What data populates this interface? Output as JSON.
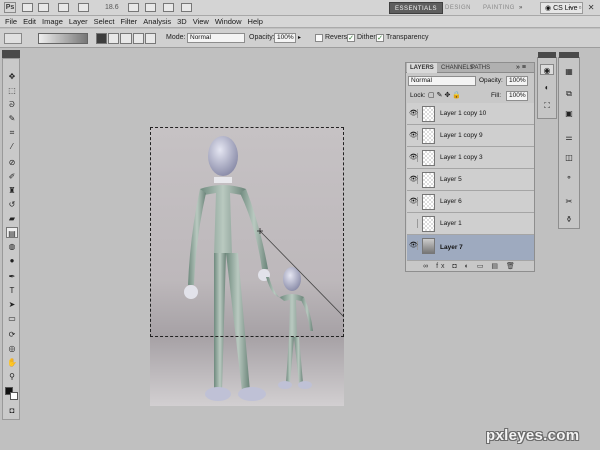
{
  "app": {
    "logo": "Ps",
    "zoom": "18.6",
    "workspaces": [
      "ESSENTIALS",
      "DESIGN",
      "PAINTING"
    ],
    "more": "»",
    "cs_live": "CS Live",
    "window_controls": "– ▫ ✕"
  },
  "menu": [
    "File",
    "Edit",
    "Image",
    "Layer",
    "Select",
    "Filter",
    "Analysis",
    "3D",
    "View",
    "Window",
    "Help"
  ],
  "options": {
    "mode_label": "Mode:",
    "mode_value": "Normal",
    "opacity_label": "Opacity:",
    "opacity_value": "100%",
    "reverse_label": "Reverse",
    "dither_label": "Dither",
    "transparency_label": "Transparency",
    "reverse_checked": false,
    "dither_checked": true,
    "transparency_checked": true
  },
  "tools": [
    "move-icon",
    "marquee-icon",
    "lasso-icon",
    "quick-select-icon",
    "crop-icon",
    "eyedropper-icon",
    "healing-brush-icon",
    "brush-icon",
    "clone-stamp-icon",
    "history-brush-icon",
    "eraser-icon",
    "gradient-icon",
    "blur-icon",
    "dodge-icon",
    "pen-icon",
    "type-icon",
    "path-selection-icon",
    "shape-icon",
    "3d-rotate-icon",
    "3d-orbit-icon",
    "hand-icon",
    "zoom-icon"
  ],
  "layers_panel": {
    "tabs": [
      "LAYERS",
      "CHANNELS",
      "PATHS"
    ],
    "menu_glyph": "»  ≡",
    "blend_mode": "Normal",
    "opacity_label": "Opacity:",
    "opacity_value": "100%",
    "lock_label": "Lock:",
    "fill_label": "Fill:",
    "fill_value": "100%",
    "layers": [
      {
        "name": "Layer 1 copy 10",
        "visible": true,
        "selected": false
      },
      {
        "name": "Layer 1 copy 9",
        "visible": true,
        "selected": false
      },
      {
        "name": "Layer 1 copy 3",
        "visible": true,
        "selected": false
      },
      {
        "name": "Layer 5",
        "visible": true,
        "selected": false
      },
      {
        "name": "Layer 6",
        "visible": true,
        "selected": false
      },
      {
        "name": "Layer 1",
        "visible": false,
        "selected": false
      },
      {
        "name": "Layer 7",
        "visible": true,
        "selected": true
      }
    ],
    "footer_icons": "∞ fx ◘ ◐ ▭ ▤ 🗑"
  },
  "watermark": "pxleyes.com",
  "colors": {
    "workspace_bg": "#c0c0c0",
    "panel_bg": "#c8c8c8",
    "selected_layer": "#9eaabf",
    "active_workspace": "#5e5e5e"
  }
}
